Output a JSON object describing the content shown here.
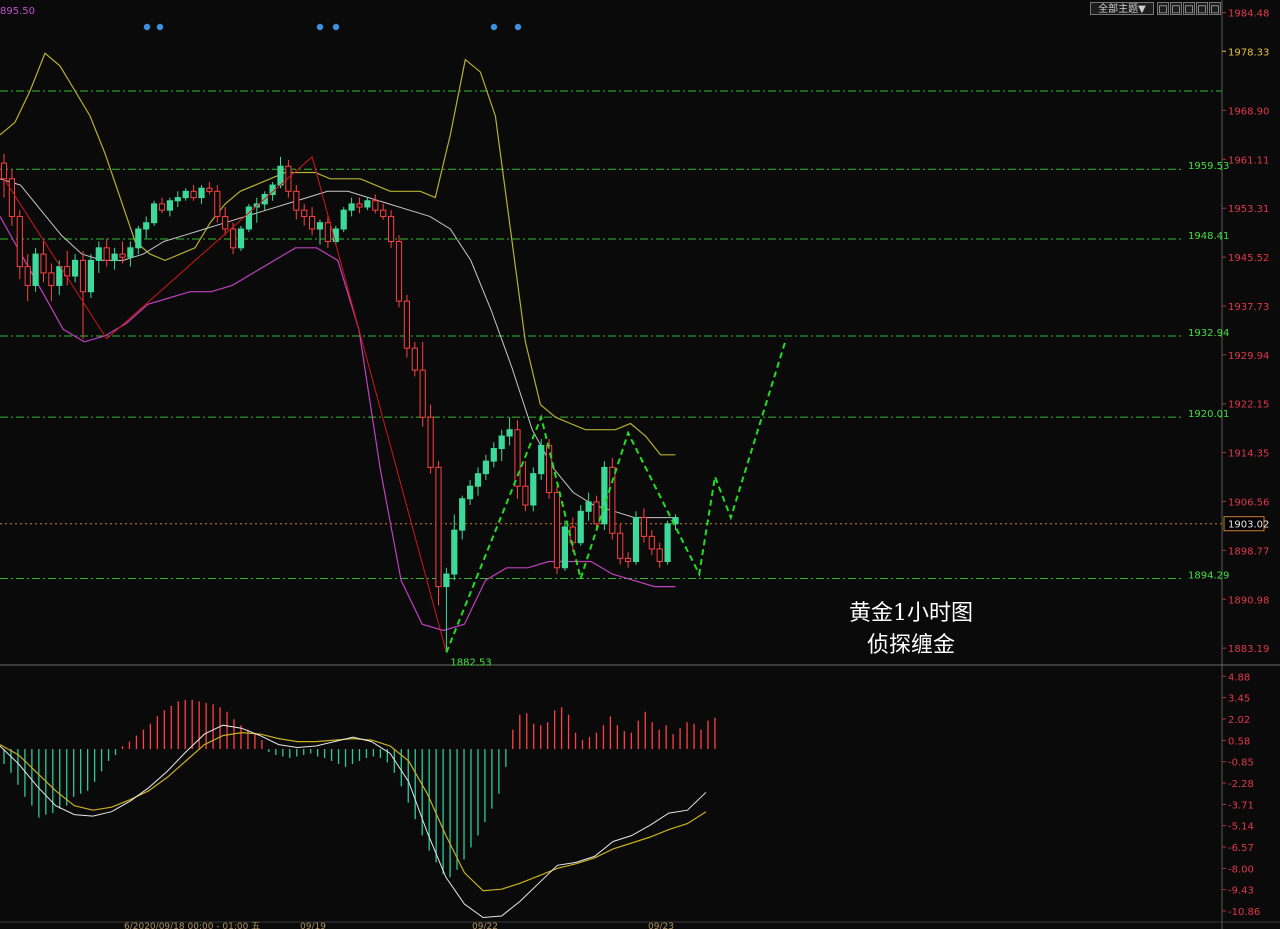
{
  "toolbar": {
    "menu_label": "全部主题▼",
    "buttons": [
      "□",
      "□",
      "□",
      "□",
      "□"
    ]
  },
  "caption": {
    "line1": "黄金1小时图",
    "line2": "侦探缠金"
  },
  "colors": {
    "background": "#0a0a0a",
    "bull_candle": "#3cd99a",
    "bear_candle": "#ff4040",
    "upper_band": "#b8b030",
    "middle_band": "#c8c8c8",
    "lower_band": "#c040c0",
    "level_line": "#2ebc2e",
    "projection": "#22dd22",
    "red_line": "#d01818",
    "price_axis_text": "#e03848",
    "macd_dif": "#e8e8e8",
    "macd_dea": "#c8b020"
  },
  "chart_data": [
    {
      "type": "candlestick",
      "title": "黄金1小时图",
      "subtitle": "侦探缠金",
      "top_left_label": "895.50",
      "ylim": [
        1880.5,
        1986.5
      ],
      "y_ticks": [
        "1984.48",
        "1968.90",
        "1961.11",
        "1953.31",
        "1945.52",
        "1937.73",
        "1929.94",
        "1922.15",
        "1914.35",
        "1906.56",
        "1898.77",
        "1890.98",
        "1883.19"
      ],
      "highlight_ticks": [
        {
          "value": "1978.33",
          "color": "#e8c040"
        }
      ],
      "current_price": "1903.02",
      "horizontal_levels": [
        "1959.53",
        "1948.41",
        "1932.94",
        "1920.01",
        "1894.29"
      ],
      "low_label": "1882.53",
      "x_labels": [
        "6/2020/09/18 00:00 - 01:00 五",
        "09/19",
        "09/22",
        "09/23"
      ],
      "signal_dots_x_positions": "three pairs along top",
      "candles": [
        [
          1960.5,
          1962.0,
          1955.0,
          1958.0
        ],
        [
          1958.0,
          1959.5,
          1950.5,
          1952.0
        ],
        [
          1952.0,
          1953.0,
          1942.0,
          1944.0
        ],
        [
          1944.0,
          1946.0,
          1938.5,
          1941.0
        ],
        [
          1941.0,
          1947.0,
          1940.0,
          1946.0
        ],
        [
          1946.0,
          1948.0,
          1941.5,
          1943.0
        ],
        [
          1943.0,
          1944.5,
          1938.5,
          1941.0
        ],
        [
          1941.0,
          1945.0,
          1939.5,
          1944.0
        ],
        [
          1944.0,
          1946.5,
          1941.0,
          1942.5
        ],
        [
          1942.5,
          1946.0,
          1941.5,
          1945.0
        ],
        [
          1945.0,
          1946.5,
          1932.5,
          1940.0
        ],
        [
          1940.0,
          1946.0,
          1939.0,
          1945.0
        ],
        [
          1945.0,
          1948.0,
          1943.0,
          1947.0
        ],
        [
          1947.0,
          1948.5,
          1944.0,
          1945.0
        ],
        [
          1945.0,
          1947.0,
          1943.5,
          1946.0
        ],
        [
          1946.0,
          1948.0,
          1944.5,
          1945.5
        ],
        [
          1945.5,
          1948.0,
          1944.0,
          1947.0
        ],
        [
          1947.0,
          1950.5,
          1946.0,
          1950.0
        ],
        [
          1950.0,
          1952.0,
          1948.5,
          1951.0
        ],
        [
          1951.0,
          1954.5,
          1950.5,
          1954.0
        ],
        [
          1954.0,
          1955.0,
          1952.5,
          1953.0
        ],
        [
          1953.0,
          1955.0,
          1952.0,
          1954.5
        ],
        [
          1954.5,
          1956.0,
          1953.5,
          1955.0
        ],
        [
          1955.0,
          1956.5,
          1954.5,
          1956.0
        ],
        [
          1956.0,
          1957.0,
          1954.5,
          1955.0
        ],
        [
          1955.0,
          1957.0,
          1954.0,
          1956.5
        ],
        [
          1956.5,
          1957.5,
          1955.5,
          1956.0
        ],
        [
          1956.0,
          1957.0,
          1951.0,
          1952.0
        ],
        [
          1952.0,
          1953.5,
          1949.0,
          1950.0
        ],
        [
          1950.0,
          1951.0,
          1946.0,
          1947.0
        ],
        [
          1947.0,
          1950.5,
          1946.5,
          1950.0
        ],
        [
          1950.0,
          1954.0,
          1949.5,
          1953.5
        ],
        [
          1953.5,
          1955.0,
          1951.0,
          1954.0
        ],
        [
          1954.0,
          1956.0,
          1953.0,
          1955.5
        ],
        [
          1955.5,
          1957.5,
          1954.5,
          1957.0
        ],
        [
          1957.0,
          1961.5,
          1956.5,
          1960.0
        ],
        [
          1960.0,
          1961.0,
          1955.0,
          1956.0
        ],
        [
          1956.0,
          1957.0,
          1951.5,
          1953.0
        ],
        [
          1953.0,
          1954.0,
          1950.5,
          1952.0
        ],
        [
          1952.0,
          1953.5,
          1949.0,
          1950.0
        ],
        [
          1950.0,
          1951.5,
          1947.5,
          1951.0
        ],
        [
          1951.0,
          1952.0,
          1947.0,
          1948.0
        ],
        [
          1948.0,
          1950.5,
          1947.5,
          1950.0
        ],
        [
          1950.0,
          1953.5,
          1949.5,
          1953.0
        ],
        [
          1953.0,
          1955.0,
          1952.0,
          1954.0
        ],
        [
          1954.0,
          1955.0,
          1952.5,
          1953.5
        ],
        [
          1953.5,
          1955.0,
          1953.0,
          1954.5
        ],
        [
          1954.5,
          1955.5,
          1952.5,
          1953.0
        ],
        [
          1953.0,
          1954.0,
          1951.5,
          1952.0
        ],
        [
          1952.0,
          1953.0,
          1947.0,
          1948.0
        ],
        [
          1948.0,
          1949.0,
          1937.5,
          1938.5
        ],
        [
          1938.5,
          1939.5,
          1929.5,
          1931.0
        ],
        [
          1931.0,
          1932.0,
          1926.5,
          1927.5
        ],
        [
          1927.5,
          1932.0,
          1918.5,
          1920.0
        ],
        [
          1920.0,
          1922.0,
          1911.0,
          1912.0
        ],
        [
          1912.0,
          1913.0,
          1890.0,
          1893.0
        ],
        [
          1893.0,
          1896.0,
          1882.5,
          1895.0
        ],
        [
          1895.0,
          1904.5,
          1894.0,
          1902.0
        ],
        [
          1902.0,
          1907.5,
          1900.5,
          1907.0
        ],
        [
          1907.0,
          1910.0,
          1906.0,
          1909.0
        ],
        [
          1909.0,
          1912.0,
          1907.5,
          1911.0
        ],
        [
          1911.0,
          1914.0,
          1910.0,
          1913.0
        ],
        [
          1913.0,
          1916.0,
          1912.0,
          1915.0
        ],
        [
          1915.0,
          1918.0,
          1913.0,
          1917.0
        ],
        [
          1917.0,
          1920.0,
          1915.5,
          1918.0
        ],
        [
          1918.0,
          1919.5,
          1907.0,
          1909.0
        ],
        [
          1909.0,
          1913.0,
          1905.0,
          1906.0
        ],
        [
          1906.0,
          1912.0,
          1905.0,
          1911.0
        ],
        [
          1911.0,
          1916.5,
          1910.0,
          1915.5
        ],
        [
          1915.5,
          1916.5,
          1907.0,
          1908.0
        ],
        [
          1908.0,
          1909.0,
          1895.0,
          1896.0
        ],
        [
          1896.0,
          1903.5,
          1895.5,
          1902.5
        ],
        [
          1902.5,
          1904.0,
          1898.5,
          1900.0
        ],
        [
          1900.0,
          1906.0,
          1899.5,
          1905.0
        ],
        [
          1905.0,
          1908.0,
          1903.5,
          1906.5
        ],
        [
          1906.5,
          1907.5,
          1902.0,
          1903.0
        ],
        [
          1903.0,
          1913.0,
          1902.0,
          1912.0
        ],
        [
          1912.0,
          1913.5,
          1900.5,
          1901.5
        ],
        [
          1901.5,
          1903.0,
          1896.5,
          1897.5
        ],
        [
          1897.5,
          1898.5,
          1896.0,
          1897.0
        ],
        [
          1897.0,
          1905.0,
          1896.5,
          1904.0
        ],
        [
          1904.0,
          1905.5,
          1900.0,
          1901.0
        ],
        [
          1901.0,
          1902.0,
          1898.0,
          1899.0
        ],
        [
          1899.0,
          1900.0,
          1896.0,
          1897.0
        ],
        [
          1897.0,
          1903.5,
          1896.5,
          1903.0
        ],
        [
          1903.0,
          1904.5,
          1902.0,
          1904.0
        ]
      ],
      "bollinger": {
        "upper": [
          1965,
          1967,
          1972,
          1978,
          1976,
          1972,
          1968,
          1962,
          1955,
          1948,
          1946,
          1945,
          1946,
          1947,
          1951,
          1954,
          1956,
          1957,
          1958,
          1959,
          1959,
          1959,
          1958,
          1958,
          1958,
          1957,
          1956,
          1956,
          1956,
          1955,
          1965,
          1977,
          1975,
          1968,
          1950,
          1932,
          1922,
          1920,
          1919,
          1918,
          1918,
          1918,
          1919,
          1917,
          1914,
          1914
        ],
        "middle": [
          1958,
          1957,
          1953,
          1949,
          1946,
          1945,
          1945,
          1946,
          1948,
          1949,
          1950,
          1951,
          1952,
          1953,
          1954,
          1955,
          1956,
          1956,
          1955,
          1954,
          1953,
          1952,
          1950,
          1945,
          1937,
          1928,
          1918,
          1912,
          1908,
          1906,
          1905,
          1904,
          1904,
          1904
        ],
        "lower": [
          1952,
          1946,
          1940,
          1934,
          1932,
          1933,
          1935,
          1938,
          1939,
          1940,
          1940,
          1941,
          1943,
          1945,
          1947,
          1947,
          1945,
          1934,
          1912,
          1894,
          1887,
          1886,
          1887,
          1894,
          1896,
          1896,
          1897,
          1897,
          1897,
          1895,
          1894,
          1893,
          1893
        ]
      }
    },
    {
      "type": "macd",
      "y_ticks": [
        "4.88",
        "3.45",
        "2.02",
        "0.58",
        "-0.85",
        "-2.28",
        "-3.71",
        "-5.14",
        "-6.57",
        "-8.00",
        "-9.43",
        "-10.86"
      ],
      "ylim": [
        -11.6,
        5.3
      ],
      "histogram": [
        -1.0,
        -1.6,
        -2.4,
        -3.2,
        -3.8,
        -4.6,
        -4.4,
        -4.3,
        -4.0,
        -3.8,
        -3.2,
        -3.0,
        -2.8,
        -2.2,
        -1.5,
        -0.8,
        -0.4,
        0.2,
        0.5,
        0.9,
        1.3,
        1.7,
        2.2,
        2.6,
        2.9,
        3.2,
        3.3,
        3.3,
        3.2,
        3.1,
        3.0,
        2.8,
        2.5,
        2.0,
        1.6,
        1.3,
        1.0,
        0.6,
        -0.2,
        -0.4,
        -0.5,
        -0.6,
        -0.5,
        -0.4,
        -0.3,
        -0.5,
        -0.6,
        -0.8,
        -1.0,
        -1.2,
        -1.0,
        -0.8,
        -0.6,
        -0.5,
        -0.6,
        -0.9,
        -1.6,
        -2.5,
        -3.6,
        -4.7,
        -5.8,
        -6.8,
        -7.6,
        -8.4,
        -8.6,
        -8.1,
        -7.4,
        -6.6,
        -5.8,
        -4.9,
        -4.0,
        -3.0,
        -1.2,
        1.3,
        2.3,
        2.4,
        1.7,
        1.6,
        1.8,
        2.6,
        2.8,
        2.3,
        1.1,
        0.6,
        0.8,
        1.1,
        1.6,
        2.2,
        1.6,
        1.2,
        1.1,
        1.9,
        2.5,
        1.8,
        1.3,
        1.6,
        1.0,
        1.4,
        1.8,
        1.7,
        1.3,
        1.9,
        2.1
      ],
      "dif": [
        0.2,
        -1,
        -2.5,
        -3.8,
        -4.4,
        -4.5,
        -4.2,
        -3.5,
        -2.6,
        -1.5,
        -0.2,
        1.0,
        1.6,
        1.4,
        0.9,
        0.3,
        0.1,
        0.2,
        0.5,
        0.8,
        0.5,
        -0.3,
        -2.2,
        -5.6,
        -8.6,
        -10.4,
        -11.3,
        -11.2,
        -10.2,
        -9.0,
        -7.8,
        -7.6,
        -7.2,
        -6.2,
        -5.8,
        -5.1,
        -4.3,
        -4.1,
        -2.9
      ],
      "dea": [
        0.3,
        -0.4,
        -1.6,
        -2.8,
        -3.8,
        -4.1,
        -3.9,
        -3.4,
        -2.8,
        -1.9,
        -0.8,
        0.3,
        0.9,
        1.1,
        1.0,
        0.7,
        0.5,
        0.5,
        0.6,
        0.7,
        0.6,
        0.2,
        -0.8,
        -3.0,
        -5.8,
        -8.3,
        -9.5,
        -9.4,
        -9.0,
        -8.5,
        -8.0,
        -7.7,
        -7.3,
        -6.7,
        -6.3,
        -5.9,
        -5.4,
        -5.0,
        -4.2
      ]
    }
  ]
}
